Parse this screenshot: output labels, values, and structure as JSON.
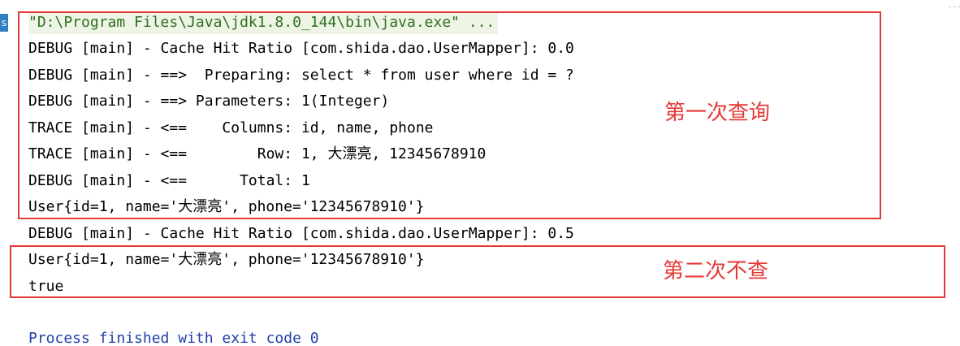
{
  "sidebar": {
    "tab_letter": "s"
  },
  "console": {
    "lines": [
      "\"D:\\Program Files\\Java\\jdk1.8.0_144\\bin\\java.exe\" ...",
      "DEBUG [main] - Cache Hit Ratio [com.shida.dao.UserMapper]: 0.0",
      "DEBUG [main] - ==>  Preparing: select * from user where id = ?",
      "DEBUG [main] - ==> Parameters: 1(Integer)",
      "TRACE [main] - <==    Columns: id, name, phone",
      "TRACE [main] - <==        Row: 1, 大漂亮, 12345678910",
      "DEBUG [main] - <==      Total: 1",
      "User{id=1, name='大漂亮', phone='12345678910'}",
      "DEBUG [main] - Cache Hit Ratio [com.shida.dao.UserMapper]: 0.5",
      "User{id=1, name='大漂亮', phone='12345678910'}",
      "true",
      "",
      "Process finished with exit code 0"
    ]
  },
  "annotations": {
    "first_query": "第一次查询",
    "second_no_query": "第二次不查"
  },
  "colors": {
    "highlight_box": "#e53935",
    "command_line_text": "#2f6f1f",
    "command_line_bg": "#eef5e7",
    "exit_text": "#1f3fa8"
  }
}
